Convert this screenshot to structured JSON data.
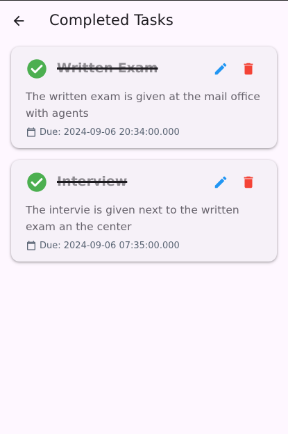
{
  "header": {
    "title": "Completed Tasks",
    "back_icon": "arrow-back-icon"
  },
  "colors": {
    "background": "#FEF7FF",
    "card": "#F6F1F8",
    "check": "#4CAF50",
    "edit": "#2196F3",
    "delete": "#F44336"
  },
  "tasks": [
    {
      "title": "Written Exam",
      "description": "The written exam is given at the mail office with agents",
      "due": "Due: 2024-09-06 20:34:00.000",
      "completed": true
    },
    {
      "title": "Interview",
      "description": "The intervie is given next to the written exam an the center",
      "due": "Due: 2024-09-06 07:35:00.000",
      "completed": true
    }
  ]
}
